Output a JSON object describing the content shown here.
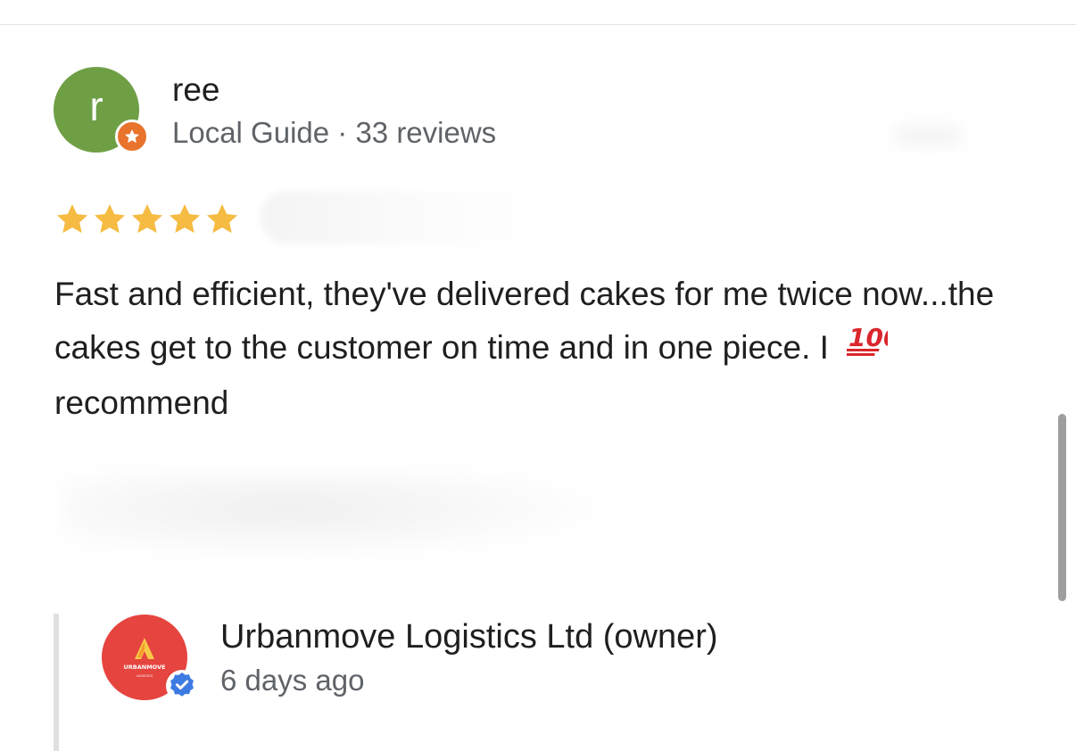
{
  "reviewer": {
    "initial": "r",
    "name": "ree",
    "meta": "Local Guide · 33 reviews",
    "avatar_color": "#6e9f45",
    "badge_color": "#e8732c",
    "badge_icon": "star-icon"
  },
  "review": {
    "rating": 5,
    "star_color": "#f6bb42",
    "text_before_emoji": "Fast and efficient, they've delivered cakes for me twice now...the cakes get to the customer on time and in one piece. I",
    "emoji": "100",
    "text_after_emoji": "recommend"
  },
  "owner_reply": {
    "name": "Urbanmove Logistics Ltd (owner)",
    "time": "6 days ago",
    "logo_text": "URBANMOVE",
    "logo_subtext": "LOGISTICS",
    "avatar_color": "#e5443f",
    "verified_color": "#3d7be3",
    "verified_icon": "verified-check-icon"
  }
}
